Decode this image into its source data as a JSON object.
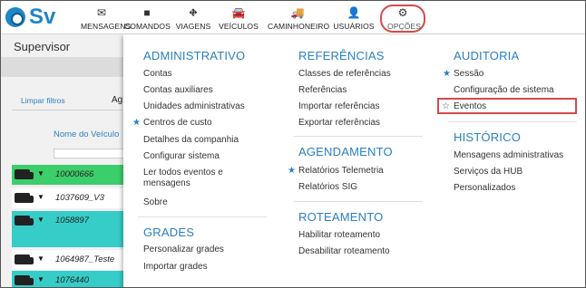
{
  "app": {
    "logo_text": "Sv"
  },
  "nav": [
    {
      "label": "MENSAGENS",
      "icon": "envelope-icon",
      "glyph": "✉"
    },
    {
      "label": "COMANDOS",
      "icon": "command-icon",
      "glyph": "■"
    },
    {
      "label": "VIAGENS",
      "icon": "road-icon",
      "glyph": "⛖"
    },
    {
      "label": "VEÍCULOS",
      "icon": "car-icon",
      "glyph": "🚘"
    },
    {
      "label": "CAMINHONEIRO",
      "icon": "driver-icon",
      "glyph": "🚚"
    },
    {
      "label": "USUÁRIOS",
      "icon": "user-icon",
      "glyph": "👤"
    },
    {
      "label": "OPÇÕES",
      "icon": "gears-icon",
      "glyph": "⚙"
    }
  ],
  "page": {
    "title": "Supervisor",
    "clear_filters": "Limpar filtros",
    "ag_text": "Ag",
    "column_header": "Nome do Veículo",
    "rows": [
      {
        "id": "10000666",
        "color": "#3cce6a"
      },
      {
        "id": "1037609_V3",
        "color": "#ffffff"
      },
      {
        "id": "1058897",
        "color": "#36cdc8"
      },
      {
        "id": "1064987_Teste",
        "color": "#ffffff"
      },
      {
        "id": "1076440",
        "color": "#36cdc8"
      }
    ]
  },
  "menu": {
    "administrativo": {
      "title": "ADMINISTRATIVO",
      "items": [
        {
          "label": "Contas",
          "star": ""
        },
        {
          "label": "Contas auxiliares",
          "star": ""
        },
        {
          "label": "Unidades administrativas",
          "star": ""
        },
        {
          "label": "Centros de custo",
          "star": "filled"
        },
        {
          "label": "Detalhes da companhia",
          "star": ""
        },
        {
          "label": "Configurar sistema",
          "star": ""
        },
        {
          "label": "Ler todos eventos e mensagens",
          "star": ""
        },
        {
          "label": "Sobre",
          "star": ""
        }
      ]
    },
    "grades": {
      "title": "GRADES",
      "items": [
        {
          "label": "Personalizar grades"
        },
        {
          "label": "Importar grades"
        }
      ]
    },
    "referencias": {
      "title": "REFERÊNCIAS",
      "items": [
        {
          "label": "Classes de referências"
        },
        {
          "label": "Referências"
        },
        {
          "label": "Importar referências"
        },
        {
          "label": "Exportar referências"
        }
      ]
    },
    "agendamento": {
      "title": "AGENDAMENTO",
      "items": [
        {
          "label": "Relatórios Telemetria",
          "star": "filled"
        },
        {
          "label": "Relatórios SIG",
          "star": ""
        }
      ]
    },
    "roteamento": {
      "title": "ROTEAMENTO",
      "items": [
        {
          "label": "Habilitar roteamento"
        },
        {
          "label": "Desabilitar roteamento"
        }
      ]
    },
    "auditoria": {
      "title": "AUDITORIA",
      "items": [
        {
          "label": "Sessão",
          "star": "filled"
        },
        {
          "label": "Configuração de sistema",
          "star": ""
        },
        {
          "label": "Eventos",
          "star": "outline"
        }
      ]
    },
    "historico": {
      "title": "HISTÓRICO",
      "items": [
        {
          "label": "Mensagens administrativas"
        },
        {
          "label": "Serviços da HUB"
        },
        {
          "label": "Personalizados"
        }
      ]
    }
  },
  "colors": {
    "accent": "#2a7fc0",
    "highlight": "#d34b4b"
  }
}
